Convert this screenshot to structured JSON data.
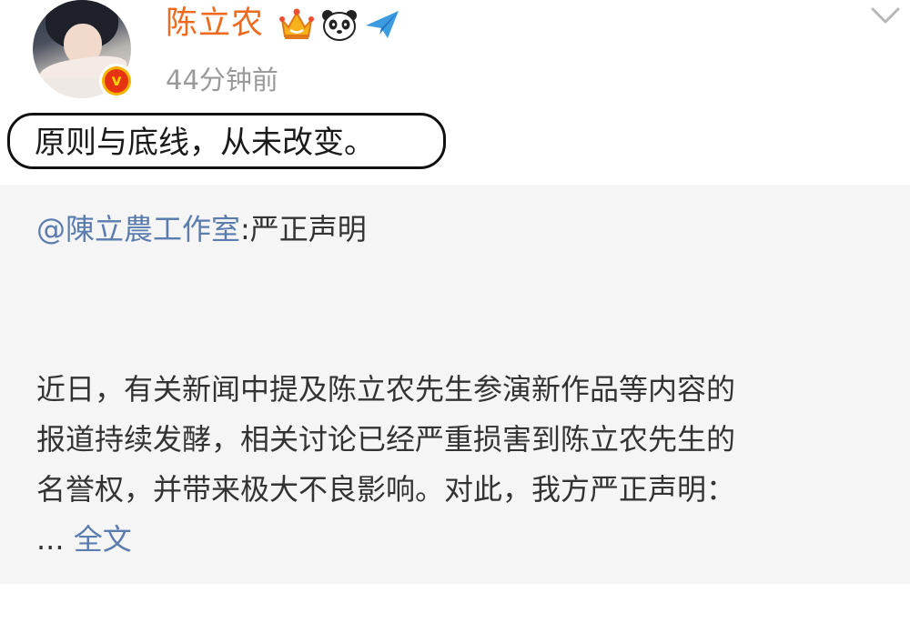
{
  "post": {
    "username": "陈立农",
    "timestamp": "44分钟前",
    "text": "原则与底线，从未改变。",
    "badges": [
      "crown-icon",
      "panda-icon",
      "paper-plane-icon"
    ],
    "verified_badge": "v-verified-icon"
  },
  "repost": {
    "mention": "@陳立農工作室",
    "title": ":严正声明",
    "body_lines": [
      "近日，有关新闻中提及陈立农先生参演新作品等内容的",
      "报道持续发酵，相关讨论已经严重损害到陈立农先生的",
      "名誉权，并带来极大不良影响。对此，我方严正声明："
    ],
    "ellipsis": "...",
    "fulltext_link": "全文"
  },
  "colors": {
    "username": "#f06a1e",
    "timestamp": "#9a9a9a",
    "link": "#5b7cae",
    "repost_bg": "#f5f5f5",
    "text": "#1a1a1a"
  }
}
